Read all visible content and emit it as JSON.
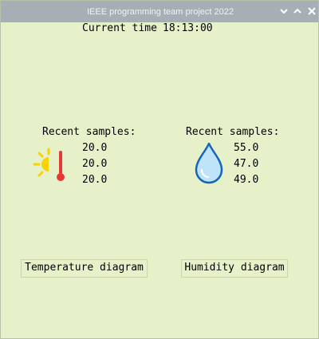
{
  "window": {
    "title": "IEEE programming team project 2022",
    "controls": [
      "minimize",
      "maximize",
      "close"
    ]
  },
  "header": {
    "current_time_label": "Current time",
    "current_time_value": "18:13:00"
  },
  "temperature": {
    "icon": "sun-thermometer-icon",
    "recent_label": "Recent samples:",
    "samples": [
      "20.0",
      "20.0",
      "20.0"
    ],
    "diagram_button": "Temperature diagram"
  },
  "humidity": {
    "icon": "water-drop-icon",
    "recent_label": "Recent samples:",
    "samples": [
      "55.0",
      "47.0",
      "49.0"
    ],
    "diagram_button": "Humidity diagram"
  },
  "colors": {
    "background": "#e6f1c9",
    "titlebar": "#a8aeb5",
    "sun": "#f5d20a",
    "thermometer": "#e53935",
    "drop_fill": "#bfe3f8",
    "drop_stroke": "#1565c0"
  }
}
